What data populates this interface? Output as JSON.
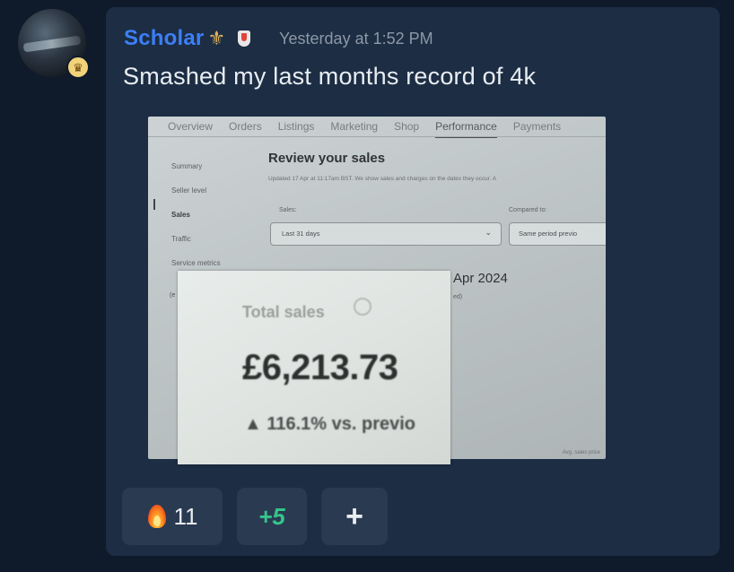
{
  "message": {
    "username": "Scholar",
    "username_icon": "fleur-de-lis-icon",
    "badge_icon": "shield-badge-icon",
    "timestamp": "Yesterday at 1:52 PM",
    "text": "Smashed my last months record of 4k",
    "avatar_badge_icon": "crown-icon"
  },
  "attachment": {
    "tabs": [
      "Overview",
      "Orders",
      "Listings",
      "Marketing",
      "Shop",
      "Performance",
      "Payments"
    ],
    "active_tab": "Performance",
    "side_nav": [
      "Summary",
      "Seller level",
      "Sales",
      "Traffic",
      "Service metrics"
    ],
    "selected_side": "Sales",
    "title": "Review your sales",
    "updated": "Updated 17 Apr at 11:17am BST. We show sales and charges on the dates they occur. A",
    "sales_label": "Sales:",
    "sales_value": "Last 31 days",
    "compared_label": "Compared to:",
    "compared_value": "Same period previo",
    "date_heading": "Apr 2024",
    "date_sub": "ed)",
    "left_fragment": "(e",
    "footer": "Avg. sales price",
    "zoom": {
      "label": "Total sales",
      "total": "£6,213.73",
      "change": "▲ 116.1% vs. previo"
    }
  },
  "reactions": [
    {
      "icon": "fire-icon",
      "count": "11"
    },
    {
      "text": "+5"
    },
    {
      "icon": "plus-icon",
      "symbol": "+"
    }
  ],
  "colors": {
    "background": "#0f1a2a",
    "card": "#1c2d44",
    "username": "#3d7ff5",
    "reaction_bg": "#2a3a51",
    "plus5": "#35c48a"
  }
}
